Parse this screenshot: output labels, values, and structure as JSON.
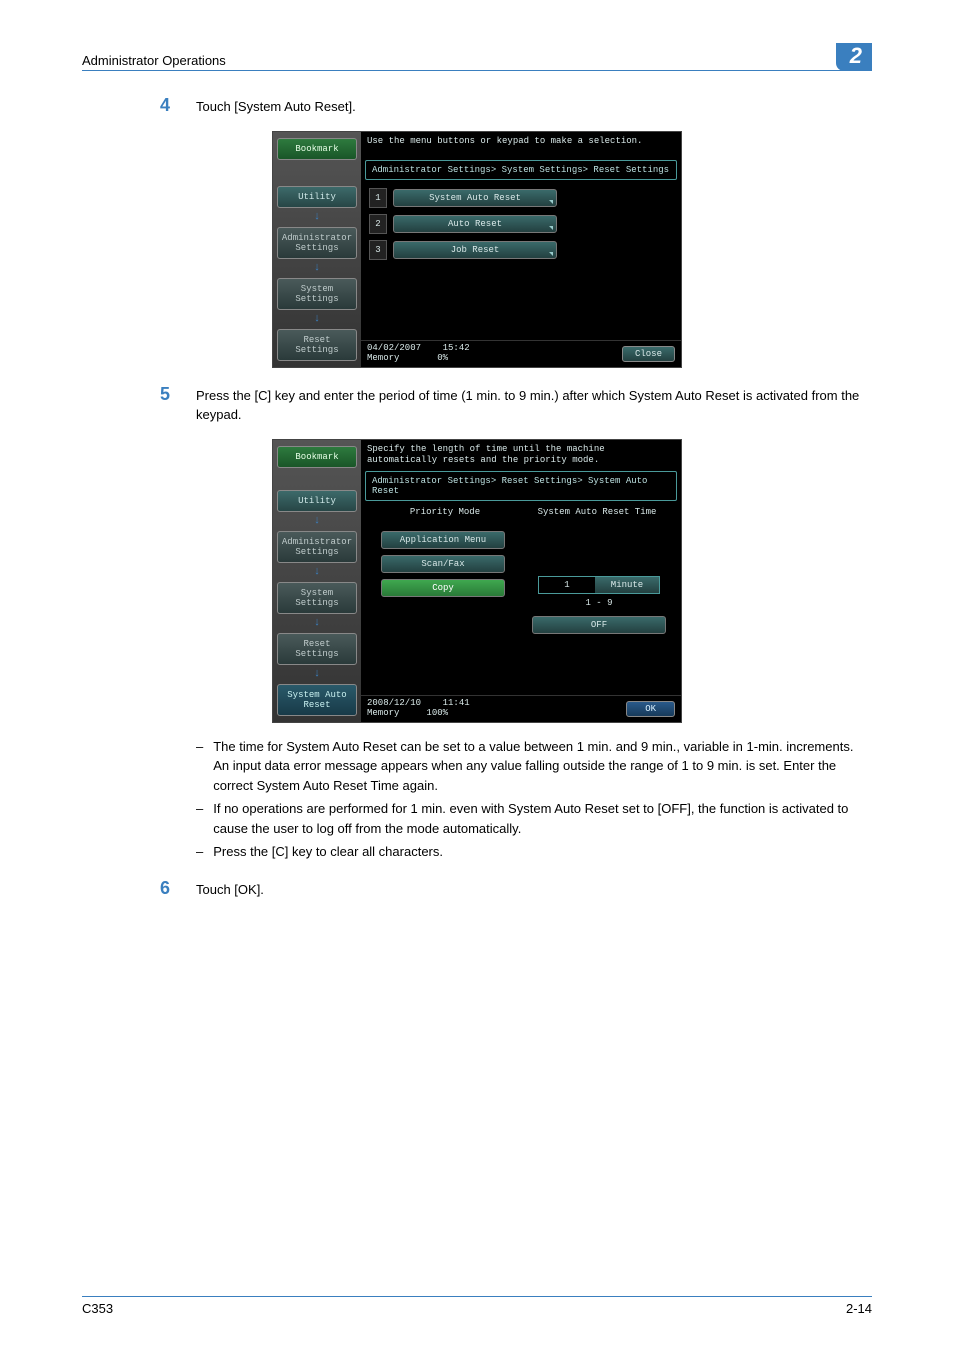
{
  "header": {
    "title": "Administrator Operations",
    "chapter": "2"
  },
  "steps": {
    "s4": {
      "num": "4",
      "text": "Touch [System Auto Reset]."
    },
    "s5": {
      "num": "5",
      "text": "Press the [C] key and enter the period of time (1 min. to 9 min.) after which System Auto Reset is activated from the keypad."
    },
    "s6": {
      "num": "6",
      "text": "Touch [OK]."
    }
  },
  "screen1": {
    "prompt": "Use the menu buttons or keypad to make a selection.",
    "path": "Administrator Settings> System Settings> Reset Settings",
    "side": {
      "bookmark": "Bookmark",
      "utility": "Utility",
      "admin": "Administrator Settings",
      "sys": "System Settings",
      "reset": "Reset Settings"
    },
    "menu": [
      {
        "n": "1",
        "label": "System Auto Reset"
      },
      {
        "n": "2",
        "label": "Auto Reset"
      },
      {
        "n": "3",
        "label": "Job Reset"
      }
    ],
    "footer": {
      "date": "04/02/2007",
      "time": "15:42",
      "mem_label": "Memory",
      "mem_val": "0%",
      "close": "Close"
    }
  },
  "screen2": {
    "prompt": "Specify the length of time until the machine automatically resets and the priority mode.",
    "path": "Administrator Settings> Reset Settings> System Auto Reset",
    "side": {
      "bookmark": "Bookmark",
      "utility": "Utility",
      "admin": "Administrator Settings",
      "sys": "System Settings",
      "reset": "Reset Settings",
      "autoreset": "System Auto Reset"
    },
    "col1": "Priority Mode",
    "col2": "System Auto Reset Time",
    "prio": {
      "app": "Application Menu",
      "scan": "Scan/Fax",
      "copy": "Copy"
    },
    "time": {
      "value": "1",
      "unit": "Minute",
      "range": "1  -  9",
      "off": "OFF"
    },
    "footer": {
      "date": "2008/12/10",
      "time": "11:41",
      "mem_label": "Memory",
      "mem_val": "100%",
      "ok": "OK"
    }
  },
  "notes": {
    "n1": "The time for System Auto Reset can be set to a value between 1 min. and 9 min., variable in 1-min. increments. An input data error message appears when any value falling outside the range of 1 to 9 min. is set. Enter the correct System Auto Reset Time again.",
    "n2": "If no operations are performed for 1 min. even with System Auto Reset set to [OFF], the function is activated to cause the user to log off from the mode automatically.",
    "n3": "Press the [C] key to clear all characters."
  },
  "footer": {
    "model": "C353",
    "page": "2-14"
  }
}
